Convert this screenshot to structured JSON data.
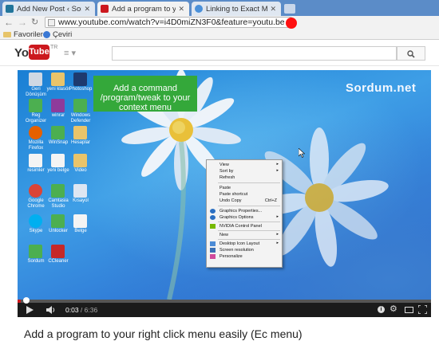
{
  "browser": {
    "tabs": [
      {
        "title": "Add New Post ‹ Sordum.n",
        "favicon_color": "#21759b"
      },
      {
        "title": "Add a program to your rig",
        "favicon_color": "#cc181e"
      },
      {
        "title": "Linking to Exact Minutes a",
        "favicon_color": "#4a90d9"
      }
    ],
    "url": "www.youtube.com/watch?v=i4D0miZN3F0&feature=youtu.be",
    "bookmarks": [
      "Favoriler",
      "Çeviri"
    ]
  },
  "youtube": {
    "logo_you": "You",
    "logo_tube": "Tube",
    "logo_region": "TR",
    "search_placeholder": ""
  },
  "video": {
    "note": "Add a command /program/tweak to your context menu",
    "watermark": "Sordum.net",
    "desktop_icons": [
      {
        "label": "Geri Dönüşüm",
        "icon": "recycle-bin-icon"
      },
      {
        "label": "yeni klasör",
        "icon": "folder-icon"
      },
      {
        "label": "Photoshop",
        "icon": "photoshop-icon"
      },
      {
        "label": "Reg Organizer",
        "icon": "app-icon"
      },
      {
        "label": "winrar",
        "icon": "winrar-icon"
      },
      {
        "label": "Windows Defender",
        "icon": "app-icon"
      },
      {
        "label": "Mozilla Firefox",
        "icon": "firefox-icon"
      },
      {
        "label": "WinSnap",
        "icon": "app-icon"
      },
      {
        "label": "Hesaplar",
        "icon": "folder-icon"
      },
      {
        "label": "resimler",
        "icon": "file-icon"
      },
      {
        "label": "yeni belge",
        "icon": "file-icon"
      },
      {
        "label": "Video",
        "icon": "folder-icon"
      },
      {
        "label": "Google Chrome",
        "icon": "chrome-icon"
      },
      {
        "label": "Camtasia Studio",
        "icon": "app-icon"
      },
      {
        "label": "Kısayol",
        "icon": "shortcut-icon"
      },
      {
        "label": "Skype",
        "icon": "skype-icon"
      },
      {
        "label": "Unlocker",
        "icon": "app-icon"
      },
      {
        "label": "Belge",
        "icon": "file-icon"
      },
      {
        "label": "Sordum",
        "icon": "app-icon"
      },
      {
        "label": "CCleaner",
        "icon": "ccleaner-icon"
      }
    ],
    "context_menu": [
      {
        "label": "View",
        "submenu": true
      },
      {
        "label": "Sort by",
        "submenu": true
      },
      {
        "label": "Refresh",
        "submenu": false
      },
      {
        "label": "Paste",
        "submenu": false
      },
      {
        "label": "Paste shortcut",
        "submenu": false
      },
      {
        "label": "Undo Copy",
        "shortcut": "Ctrl+Z"
      },
      {
        "label": "Graphics Properties...",
        "submenu": false
      },
      {
        "label": "Graphics Options",
        "submenu": true
      },
      {
        "label": "NVIDIA Control Panel",
        "submenu": false
      },
      {
        "label": "New",
        "submenu": true
      },
      {
        "label": "Desktop Icon Layout",
        "submenu": true
      },
      {
        "label": "Screen resolution",
        "submenu": false
      },
      {
        "label": "Personalize",
        "submenu": false
      }
    ],
    "time_current": "0:03",
    "time_total": "6:36",
    "progress_fraction": 0.008
  },
  "page_title": "Add a program to your right click menu easily (Ec menu)",
  "colors": {
    "brand_red": "#cc181e",
    "note_green": "#34a83a"
  }
}
